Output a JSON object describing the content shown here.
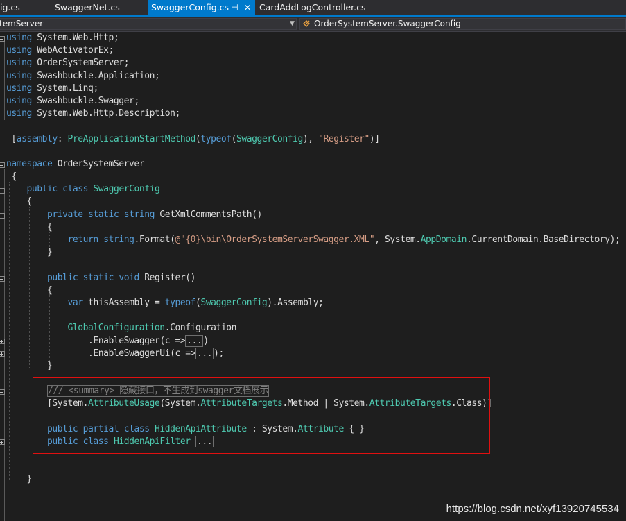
{
  "tabs": [
    {
      "label": "ig.cs",
      "active": false
    },
    {
      "label": "SwaggerNet.cs",
      "active": false
    },
    {
      "label": "SwaggerConfig.cs",
      "active": true,
      "pin_icon": "pin-icon",
      "close_icon": "close-icon"
    },
    {
      "label": "CardAddLogController.cs",
      "active": false
    }
  ],
  "nav": {
    "left_value": "temServer",
    "right_value": "OrderSystemServer.SwaggerConfig",
    "right_icon": "class-icon"
  },
  "code": {
    "using": [
      "System.Web.Http",
      "WebActivatorEx",
      "OrderSystemServer",
      "Swashbuckle.Application",
      "System.Linq",
      "Swashbuckle.Swagger",
      "System.Web.Http.Description"
    ],
    "assembly_attr": "PreApplicationStartMethod",
    "typeof_kw": "typeof",
    "swagger_config": "SwaggerConfig",
    "register_str": "\"Register\"",
    "namespace_name": "OrderSystemServer",
    "class_name": "SwaggerConfig",
    "method1": "GetXmlCommentsPath",
    "string_format_str": "@\"{0}\\bin\\OrderSystemServerSwagger.XML\"",
    "app_domain": "AppDomain",
    "current_domain": "CurrentDomain",
    "base_directory": "BaseDirectory",
    "method2": "Register",
    "var_name": "thisAssembly",
    "assembly_prop": "Assembly",
    "global_config": "GlobalConfiguration",
    "configuration": "Configuration",
    "enable_swagger": ".EnableSwagger",
    "enable_swagger_ui": ".EnableSwaggerUi",
    "collapsed_marker": "...",
    "comment": "/// <summary> 隐藏接口，不生成到swagger文档展示",
    "attribute_usage": "AttributeUsage",
    "attribute_targets": "AttributeTargets",
    "method_target": "Method",
    "class_target": "Class",
    "hidden_attr": "HiddenApiAttribute",
    "attribute_base": "Attribute",
    "hidden_filter": "HiddenApiFilter"
  },
  "watermark": "https://blog.csdn.net/xyf13920745534",
  "colors": {
    "accent": "#007acc",
    "keyword": "#569cd6",
    "type": "#4ec9b0",
    "string": "#d69d85",
    "comment": "#57a64a",
    "highlight_box": "#e01010"
  }
}
